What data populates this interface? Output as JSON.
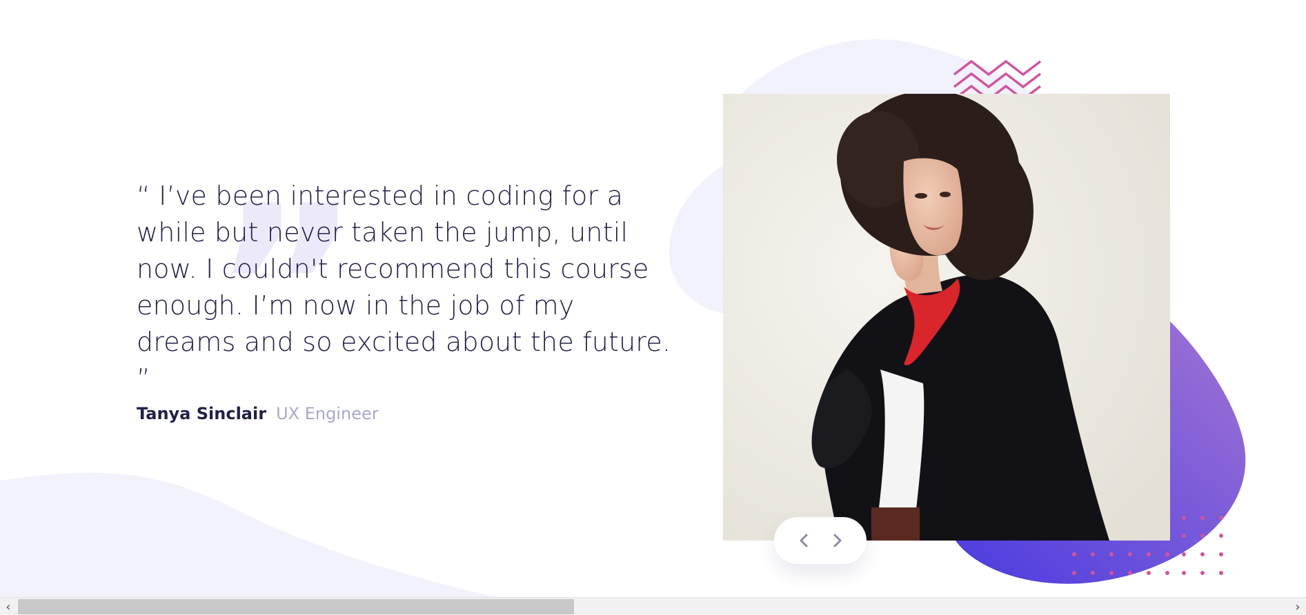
{
  "testimonial": {
    "quote": "“ I’ve been interested in coding for a while but never taken the jump, until now. I couldn't recommend this course enough. I’m now in the job of my dreams and so excited about the future. ”",
    "author_name": "Tanya Sinclair",
    "author_role": "UX Engineer",
    "quote_glyph": "”"
  },
  "slider": {
    "prev_icon": "chevron-left-icon",
    "next_icon": "chevron-right-icon"
  },
  "scrollbar": {
    "left_arrow": "‹",
    "right_arrow": "›"
  },
  "colors": {
    "text_dark": "#202048",
    "text_muted": "#a8a8c9",
    "blob_light": "#f2f2fc",
    "gradient_start": "#4a3be0",
    "gradient_end": "#9c6fd6",
    "accent_pink": "#d0559e"
  }
}
